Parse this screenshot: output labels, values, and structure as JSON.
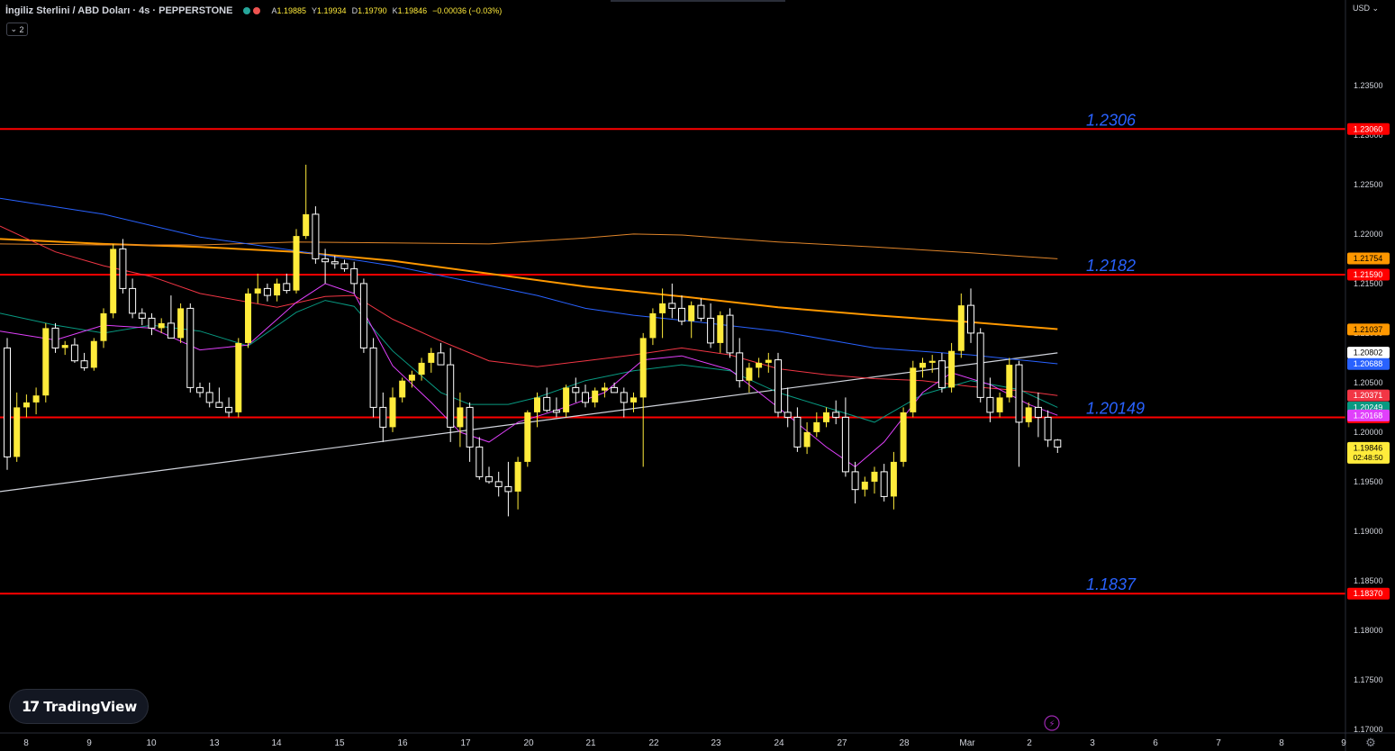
{
  "header": {
    "symbol": "İngiliz Sterlini / ABD Doları · 4s · PEPPERSTONE",
    "open_label": "A",
    "open": "1.19885",
    "high_label": "Y",
    "high": "1.19934",
    "low_label": "D",
    "low": "1.19790",
    "close_label": "K",
    "close": "1.19846",
    "change": "−0.00036 (−0.03%)",
    "indicator_count": "2",
    "indicator_toggle_icon": "chevron-down-icon",
    "status_dot_colors": [
      "#26a69a",
      "#ef5350"
    ]
  },
  "currency": "USD",
  "logo": {
    "mark": "17",
    "name": "TradingView"
  },
  "colors": {
    "background": "#000000",
    "candle_up": "#ffeb3b",
    "candle_down": "#ffffff",
    "level_line": "#ff0000",
    "level_text": "#2962ff",
    "axis_text": "#d1d4dc",
    "trendline": "#d1d4dc"
  },
  "chart_data": {
    "type": "candlestick",
    "instrument": "GBPUSD",
    "timeframe": "4s",
    "ylim": [
      1.1699,
      1.2389
    ],
    "y_ticks": [
      "1.23500",
      "1.23000",
      "1.22500",
      "1.22000",
      "1.21500",
      "1.21000",
      "1.20500",
      "1.20000",
      "1.19500",
      "1.19000",
      "1.18500",
      "1.18000",
      "1.17500",
      "1.17000"
    ],
    "x_ticks": [
      "8",
      "9",
      "10",
      "13",
      "14",
      "15",
      "16",
      "17",
      "20",
      "21",
      "22",
      "23",
      "24",
      "27",
      "28",
      "Mar",
      "2",
      "3",
      "6",
      "7",
      "8",
      "9"
    ],
    "levels": [
      {
        "label": "1.2306",
        "value": 1.2306,
        "axis_label": "1.23060"
      },
      {
        "label": "1.2182",
        "value": 1.2159,
        "axis_label": "1.21590"
      },
      {
        "label": "1.20149",
        "value": 1.20149,
        "axis_label": "1.20149"
      },
      {
        "label": "1.1837",
        "value": 1.1837,
        "axis_label": "1.18370"
      }
    ],
    "price_tags": [
      {
        "value": 1.21754,
        "text": "1.21754",
        "bg": "#ff9800",
        "fg": "#000000"
      },
      {
        "value": 1.21037,
        "text": "1.21037",
        "bg": "#ff9800",
        "fg": "#000000"
      },
      {
        "value": 1.20802,
        "text": "1.20802",
        "bg": "#ffffff",
        "fg": "#000000"
      },
      {
        "value": 1.20688,
        "text": "1.20688",
        "bg": "#2962ff",
        "fg": "#ffffff"
      },
      {
        "value": 1.20371,
        "text": "1.20371",
        "bg": "#f23645",
        "fg": "#ffffff"
      },
      {
        "value": 1.20249,
        "text": "1.20249",
        "bg": "#089981",
        "fg": "#ffffff"
      },
      {
        "value": 1.20168,
        "text": "1.20168",
        "bg": "#e040fb",
        "fg": "#ffffff"
      },
      {
        "value": 1.19846,
        "text": "1.19846",
        "sub": "02:48:50",
        "bg": "#ffeb3b",
        "fg": "#000000"
      }
    ],
    "moving_averages": [
      {
        "color": "#ff9800",
        "width": 2,
        "points": [
          [
            0,
            1.2195
          ],
          [
            10,
            1.219
          ],
          [
            20,
            1.2187
          ],
          [
            30,
            1.2182
          ],
          [
            40,
            1.2173
          ],
          [
            50,
            1.216
          ],
          [
            60,
            1.2147
          ],
          [
            70,
            1.2137
          ],
          [
            80,
            1.2126
          ],
          [
            90,
            1.2118
          ],
          [
            100,
            1.2111
          ],
          [
            109,
            1.2104
          ]
        ]
      },
      {
        "color": "#e0852a",
        "width": 1,
        "points": [
          [
            0,
            1.219
          ],
          [
            10,
            1.2189
          ],
          [
            20,
            1.2189
          ],
          [
            30,
            1.2192
          ],
          [
            40,
            1.2191
          ],
          [
            50,
            1.219
          ],
          [
            60,
            1.2196
          ],
          [
            65,
            1.22
          ],
          [
            70,
            1.2199
          ],
          [
            80,
            1.2192
          ],
          [
            90,
            1.2187
          ],
          [
            100,
            1.2181
          ],
          [
            109,
            1.2175
          ]
        ]
      },
      {
        "color": "#2962ff",
        "width": 1,
        "points": [
          [
            0,
            1.2236
          ],
          [
            10,
            1.222
          ],
          [
            20,
            1.2197
          ],
          [
            30,
            1.2183
          ],
          [
            40,
            1.2168
          ],
          [
            50,
            1.2148
          ],
          [
            55,
            1.2138
          ],
          [
            60,
            1.2125
          ],
          [
            65,
            1.2118
          ],
          [
            70,
            1.2113
          ],
          [
            80,
            1.2102
          ],
          [
            90,
            1.2085
          ],
          [
            100,
            1.2078
          ],
          [
            109,
            1.2069
          ]
        ]
      },
      {
        "color": "#f23645",
        "width": 1,
        "points": [
          [
            0,
            1.2208
          ],
          [
            5,
            1.2182
          ],
          [
            10,
            1.2168
          ],
          [
            15,
            1.2157
          ],
          [
            20,
            1.214
          ],
          [
            28,
            1.2126
          ],
          [
            33,
            1.2137
          ],
          [
            36,
            1.2138
          ],
          [
            40,
            1.2114
          ],
          [
            45,
            1.2092
          ],
          [
            50,
            1.2072
          ],
          [
            55,
            1.2066
          ],
          [
            60,
            1.2072
          ],
          [
            65,
            1.2078
          ],
          [
            70,
            1.2085
          ],
          [
            75,
            1.2078
          ],
          [
            80,
            1.2064
          ],
          [
            85,
            1.2058
          ],
          [
            90,
            1.2054
          ],
          [
            95,
            1.2052
          ],
          [
            100,
            1.2046
          ],
          [
            105,
            1.2042
          ],
          [
            109,
            1.2037
          ]
        ]
      },
      {
        "color": "#089981",
        "width": 1,
        "points": [
          [
            0,
            1.212
          ],
          [
            5,
            1.2108
          ],
          [
            10,
            1.21
          ],
          [
            15,
            1.2108
          ],
          [
            20,
            1.2102
          ],
          [
            25,
            1.2087
          ],
          [
            30,
            1.2121
          ],
          [
            33,
            1.2133
          ],
          [
            36,
            1.2127
          ],
          [
            40,
            1.2082
          ],
          [
            45,
            1.204
          ],
          [
            48,
            1.2028
          ],
          [
            52,
            1.2028
          ],
          [
            55,
            1.2035
          ],
          [
            60,
            1.2052
          ],
          [
            65,
            1.2062
          ],
          [
            70,
            1.2068
          ],
          [
            75,
            1.2062
          ],
          [
            80,
            1.204
          ],
          [
            85,
            1.2025
          ],
          [
            90,
            1.201
          ],
          [
            95,
            1.2038
          ],
          [
            100,
            1.2052
          ],
          [
            105,
            1.2043
          ],
          [
            109,
            1.2025
          ]
        ]
      },
      {
        "color": "#e040fb",
        "width": 1,
        "points": [
          [
            0,
            1.2102
          ],
          [
            5,
            1.2093
          ],
          [
            10,
            1.2108
          ],
          [
            15,
            1.2105
          ],
          [
            20,
            1.2083
          ],
          [
            25,
            1.2088
          ],
          [
            30,
            1.2131
          ],
          [
            33,
            1.215
          ],
          [
            36,
            1.214
          ],
          [
            40,
            1.2067
          ],
          [
            44,
            1.203
          ],
          [
            47,
            1.2
          ],
          [
            50,
            1.199
          ],
          [
            53,
            1.201
          ],
          [
            57,
            1.2022
          ],
          [
            62,
            1.204
          ],
          [
            66,
            1.2073
          ],
          [
            70,
            1.2077
          ],
          [
            75,
            1.2063
          ],
          [
            80,
            1.2025
          ],
          [
            85,
            1.1985
          ],
          [
            88,
            1.1965
          ],
          [
            91,
            1.199
          ],
          [
            95,
            1.204
          ],
          [
            98,
            1.206
          ],
          [
            102,
            1.2048
          ],
          [
            106,
            1.2028
          ],
          [
            109,
            1.2017
          ]
        ]
      }
    ],
    "trendline": {
      "from": [
        0,
        1.194
      ],
      "to": [
        109,
        1.208
      ]
    },
    "candles": [
      [
        1.2085,
        1.2095,
        1.1962,
        1.1975
      ],
      [
        1.1975,
        1.204,
        1.197,
        1.2025
      ],
      [
        1.2025,
        1.2038,
        1.2015,
        1.203
      ],
      [
        1.203,
        1.2045,
        1.2018,
        1.2037
      ],
      [
        1.2037,
        1.211,
        1.203,
        1.2105
      ],
      [
        1.2105,
        1.211,
        1.208,
        1.2085
      ],
      [
        1.2085,
        1.2092,
        1.2078,
        1.2088
      ],
      [
        1.2088,
        1.2095,
        1.207,
        1.2072
      ],
      [
        1.2072,
        1.208,
        1.2062,
        1.2065
      ],
      [
        1.2065,
        1.2095,
        1.2062,
        1.2092
      ],
      [
        1.2092,
        1.2125,
        1.2085,
        1.212
      ],
      [
        1.212,
        1.219,
        1.2115,
        1.2185
      ],
      [
        1.2185,
        1.2195,
        1.214,
        1.2145
      ],
      [
        1.2145,
        1.2155,
        1.2115,
        1.212
      ],
      [
        1.212,
        1.2125,
        1.2108,
        1.2115
      ],
      [
        1.2115,
        1.212,
        1.2098,
        1.2105
      ],
      [
        1.2105,
        1.2115,
        1.21,
        1.211
      ],
      [
        1.211,
        1.2138,
        1.21,
        1.2095
      ],
      [
        1.2095,
        1.213,
        1.209,
        1.2125
      ],
      [
        1.2125,
        1.213,
        1.204,
        1.2045
      ],
      [
        1.2045,
        1.205,
        1.2035,
        1.204
      ],
      [
        1.204,
        1.205,
        1.2025,
        1.203
      ],
      [
        1.203,
        1.2045,
        1.2025,
        1.2025
      ],
      [
        1.2025,
        1.2035,
        1.2015,
        1.202
      ],
      [
        1.202,
        1.2095,
        1.2015,
        1.209
      ],
      [
        1.209,
        1.2145,
        1.2085,
        1.214
      ],
      [
        1.214,
        1.216,
        1.213,
        1.2145
      ],
      [
        1.2145,
        1.215,
        1.2132,
        1.2138
      ],
      [
        1.2138,
        1.2155,
        1.2132,
        1.215
      ],
      [
        1.215,
        1.216,
        1.214,
        1.2143
      ],
      [
        1.2143,
        1.2205,
        1.214,
        1.2198
      ],
      [
        1.2198,
        1.227,
        1.2195,
        1.222
      ],
      [
        1.222,
        1.2228,
        1.217,
        1.2175
      ],
      [
        1.2175,
        1.2185,
        1.215,
        1.2172
      ],
      [
        1.2172,
        1.2178,
        1.2165,
        1.217
      ],
      [
        1.217,
        1.2174,
        1.2162,
        1.2165
      ],
      [
        1.2165,
        1.2172,
        1.214,
        1.215
      ],
      [
        1.215,
        1.2155,
        1.208,
        1.2085
      ],
      [
        1.2085,
        1.2095,
        1.2015,
        1.2025
      ],
      [
        1.2025,
        1.204,
        1.199,
        1.2005
      ],
      [
        1.2005,
        1.2045,
        1.2,
        1.2035
      ],
      [
        1.2035,
        1.2055,
        1.203,
        1.2052
      ],
      [
        1.2052,
        1.2062,
        1.2045,
        1.2058
      ],
      [
        1.2058,
        1.2075,
        1.2052,
        1.207
      ],
      [
        1.207,
        1.2085,
        1.206,
        1.208
      ],
      [
        1.208,
        1.209,
        1.207,
        1.2068
      ],
      [
        1.2068,
        1.2085,
        1.199,
        1.2005
      ],
      [
        1.2005,
        1.204,
        1.1985,
        1.2025
      ],
      [
        1.2025,
        1.203,
        1.197,
        1.1985
      ],
      [
        1.1985,
        1.1995,
        1.1952,
        1.1955
      ],
      [
        1.1955,
        1.1965,
        1.1948,
        1.195
      ],
      [
        1.195,
        1.196,
        1.1935,
        1.1945
      ],
      [
        1.1945,
        1.197,
        1.1915,
        1.194
      ],
      [
        1.194,
        1.1975,
        1.1922,
        1.197
      ],
      [
        1.197,
        1.2022,
        1.1965,
        1.202
      ],
      [
        1.202,
        1.204,
        1.2005,
        1.2035
      ],
      [
        1.2035,
        1.2045,
        1.202,
        1.2022
      ],
      [
        1.2022,
        1.2035,
        1.2015,
        1.202
      ],
      [
        1.202,
        1.2048,
        1.2015,
        1.2045
      ],
      [
        1.2045,
        1.2055,
        1.203,
        1.204
      ],
      [
        1.204,
        1.2048,
        1.2025,
        1.203
      ],
      [
        1.203,
        1.2045,
        1.2025,
        1.2042
      ],
      [
        1.2042,
        1.205,
        1.2035,
        1.2045
      ],
      [
        1.2045,
        1.205,
        1.204,
        1.204
      ],
      [
        1.204,
        1.2045,
        1.2015,
        1.203
      ],
      [
        1.203,
        1.204,
        1.202,
        1.2035
      ],
      [
        1.2035,
        1.21,
        1.1965,
        1.2095
      ],
      [
        1.2095,
        1.2125,
        1.2088,
        1.212
      ],
      [
        1.212,
        1.2145,
        1.2095,
        1.213
      ],
      [
        1.213,
        1.215,
        1.2115,
        1.2125
      ],
      [
        1.2125,
        1.2138,
        1.2108,
        1.2112
      ],
      [
        1.2112,
        1.2132,
        1.2095,
        1.2128
      ],
      [
        1.2128,
        1.2135,
        1.2112,
        1.2115
      ],
      [
        1.2115,
        1.213,
        1.2085,
        1.209
      ],
      [
        1.209,
        1.2122,
        1.208,
        1.2118
      ],
      [
        1.2118,
        1.2125,
        1.2075,
        1.208
      ],
      [
        1.208,
        1.2095,
        1.2045,
        1.2052
      ],
      [
        1.2052,
        1.207,
        1.204,
        1.2065
      ],
      [
        1.2065,
        1.2075,
        1.2055,
        1.207
      ],
      [
        1.207,
        1.208,
        1.206,
        1.2073
      ],
      [
        1.2073,
        1.208,
        1.2015,
        1.202
      ],
      [
        1.202,
        1.2045,
        1.2005,
        1.2015
      ],
      [
        1.2015,
        1.2025,
        1.198,
        1.1985
      ],
      [
        1.1985,
        1.201,
        1.1978,
        1.2
      ],
      [
        1.2,
        1.202,
        1.1995,
        1.201
      ],
      [
        1.201,
        1.2025,
        1.2005,
        1.202
      ],
      [
        1.202,
        1.2032,
        1.2008,
        1.2015
      ],
      [
        1.2015,
        1.2035,
        1.1955,
        1.196
      ],
      [
        1.196,
        1.197,
        1.1928,
        1.1942
      ],
      [
        1.1942,
        1.1955,
        1.1935,
        1.195
      ],
      [
        1.195,
        1.1965,
        1.1938,
        1.196
      ],
      [
        1.196,
        1.1968,
        1.193,
        1.1935
      ],
      [
        1.1935,
        1.198,
        1.1922,
        1.197
      ],
      [
        1.197,
        1.2025,
        1.1965,
        1.202
      ],
      [
        1.202,
        1.2072,
        1.2015,
        1.2065
      ],
      [
        1.2065,
        1.2075,
        1.2055,
        1.207
      ],
      [
        1.207,
        1.2078,
        1.206,
        1.2072
      ],
      [
        1.2072,
        1.208,
        1.204,
        1.2045
      ],
      [
        1.2045,
        1.209,
        1.204,
        1.2082
      ],
      [
        1.2082,
        1.214,
        1.2075,
        1.2128
      ],
      [
        1.2128,
        1.2145,
        1.209,
        1.21
      ],
      [
        1.21,
        1.2105,
        1.203,
        1.2035
      ],
      [
        1.2035,
        1.2055,
        1.201,
        1.202
      ],
      [
        1.202,
        1.204,
        1.2015,
        1.2035
      ],
      [
        1.2035,
        1.2075,
        1.203,
        1.2068
      ],
      [
        1.2068,
        1.2072,
        1.1965,
        1.201
      ],
      [
        1.201,
        1.203,
        1.2005,
        1.2025
      ],
      [
        1.2025,
        1.204,
        1.1995,
        1.2015
      ],
      [
        1.2015,
        1.2022,
        1.1985,
        1.1992
      ],
      [
        1.1992,
        1.1993,
        1.1979,
        1.1985
      ]
    ]
  }
}
